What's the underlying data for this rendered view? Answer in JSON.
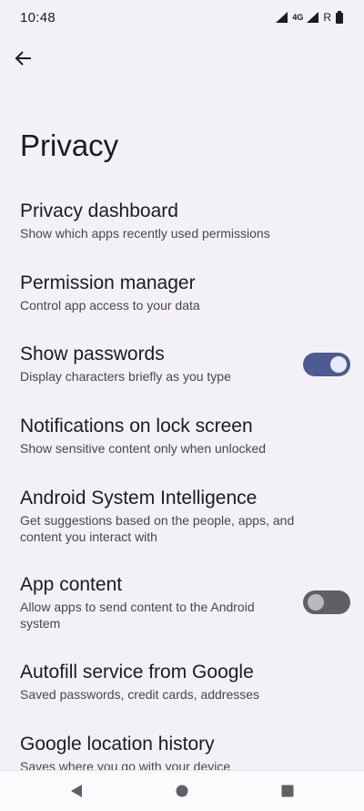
{
  "status": {
    "time": "10:48",
    "network": "4G",
    "roaming": "R",
    "icons": [
      "signal-icon",
      "network-4g-icon",
      "signal-roaming-icon",
      "battery-icon"
    ]
  },
  "header": {
    "back_icon": "arrow-back-icon",
    "title": "Privacy"
  },
  "items": [
    {
      "title": "Privacy dashboard",
      "summary": "Show which apps recently used permissions"
    },
    {
      "title": "Permission manager",
      "summary": "Control app access to your data"
    },
    {
      "title": "Show passwords",
      "summary": "Display characters briefly as you type",
      "switch": true
    },
    {
      "title": "Notifications on lock screen",
      "summary": "Show sensitive content only when unlocked"
    },
    {
      "title": "Android System Intelligence",
      "summary": "Get suggestions based on the people, apps, and content you interact with"
    },
    {
      "title": "App content",
      "summary": "Allow apps to send content to the Android system",
      "switch": false
    },
    {
      "title": "Autofill service from Google",
      "summary": "Saved passwords, credit cards, addresses"
    },
    {
      "title": "Google location history",
      "summary": "Saves where you go with your device"
    }
  ],
  "nav": {
    "back": "nav-back-icon",
    "home": "nav-home-icon",
    "recents": "nav-recents-icon"
  },
  "colors": {
    "background": "#f4f1f6",
    "switch_on": "#4e5b92",
    "switch_off": "#5f5f66"
  }
}
